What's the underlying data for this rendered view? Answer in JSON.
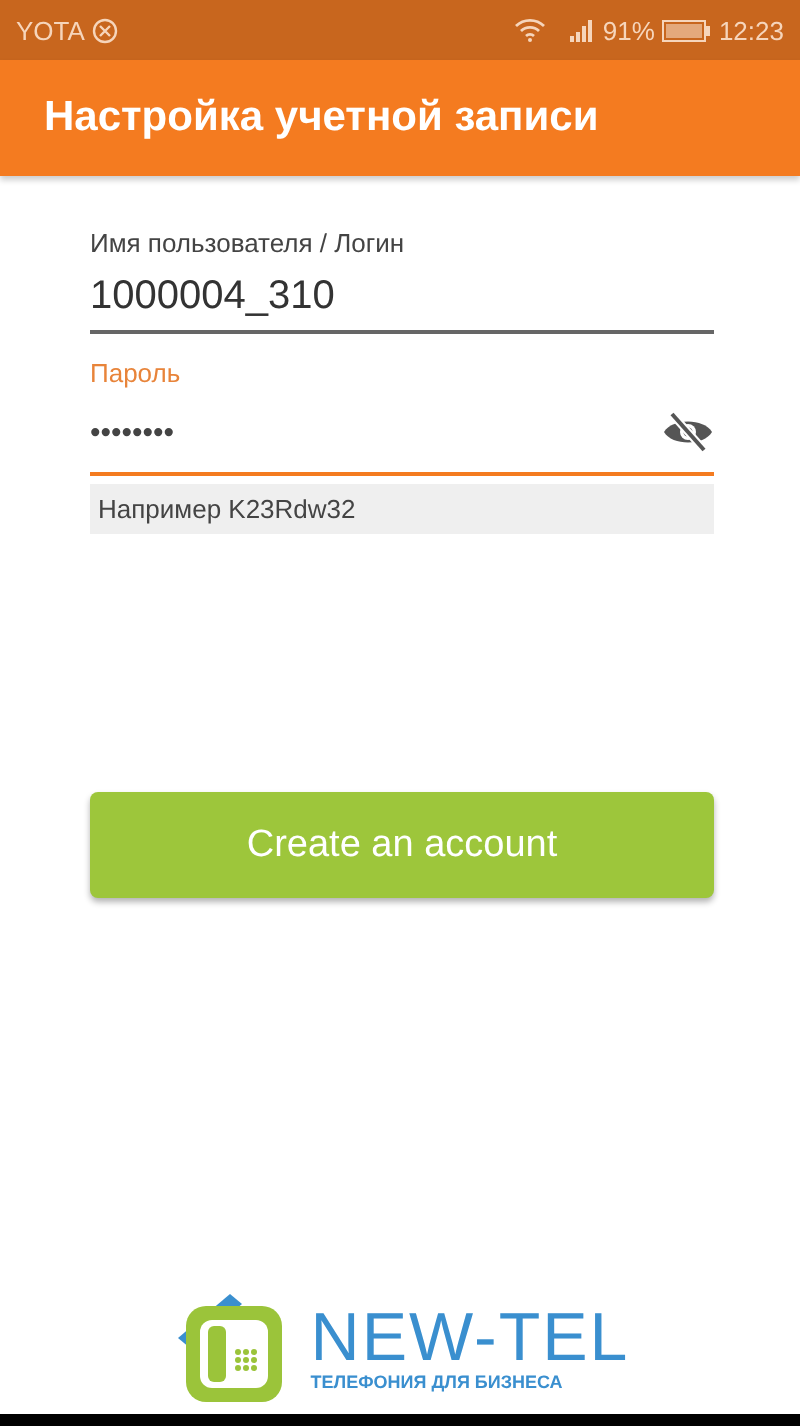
{
  "status_bar": {
    "carrier": "YOTA",
    "battery": "91%",
    "time": "12:23"
  },
  "app_bar": {
    "title": "Настройка учетной записи"
  },
  "form": {
    "username": {
      "label": "Имя пользователя / Логин",
      "value": "1000004_310",
      "focused": false
    },
    "password": {
      "label": "Пароль",
      "value": "••••••••",
      "focused": true
    },
    "hint": "Например K23Rdw32"
  },
  "button": "Create an account",
  "logo": {
    "name": "NEW-TEL",
    "tagline": "ТЕЛЕФОНИЯ ДЛЯ БИЗНЕСА"
  }
}
